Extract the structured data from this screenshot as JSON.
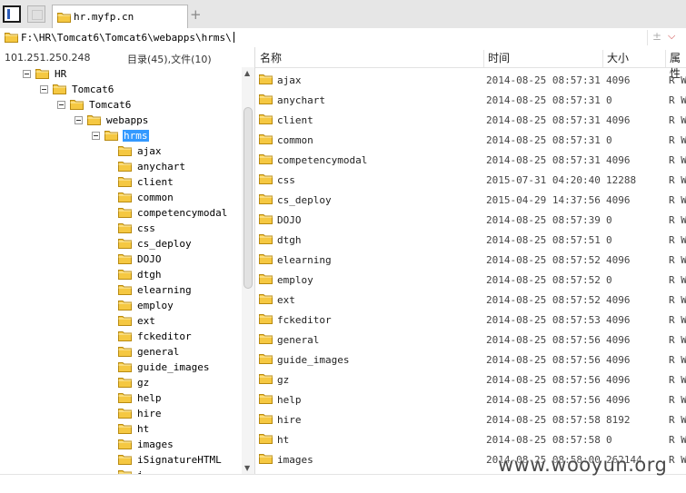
{
  "tab": {
    "title": "hr.myfp.cn",
    "add_label": "+"
  },
  "address": {
    "path": "F:\\HR\\Tomcat6\\Tomcat6\\webapps\\hrms\\",
    "plus": "±",
    "chevron": "⌵"
  },
  "left": {
    "ip": "101.251.250.248",
    "counts": "目录(45),文件(10)"
  },
  "columns": {
    "name": "名称",
    "time": "时间",
    "size": "大小",
    "attr": "属性"
  },
  "tree": [
    {
      "label": "HR",
      "depth": 0,
      "expanded": true
    },
    {
      "label": "Tomcat6",
      "depth": 1,
      "expanded": true
    },
    {
      "label": "Tomcat6",
      "depth": 2,
      "expanded": true
    },
    {
      "label": "webapps",
      "depth": 3,
      "expanded": true
    },
    {
      "label": "hrms",
      "depth": 4,
      "expanded": true,
      "selected": true
    },
    {
      "label": "ajax",
      "depth": 5
    },
    {
      "label": "anychart",
      "depth": 5
    },
    {
      "label": "client",
      "depth": 5
    },
    {
      "label": "common",
      "depth": 5
    },
    {
      "label": "competencymodal",
      "depth": 5
    },
    {
      "label": "css",
      "depth": 5
    },
    {
      "label": "cs_deploy",
      "depth": 5
    },
    {
      "label": "DOJO",
      "depth": 5
    },
    {
      "label": "dtgh",
      "depth": 5
    },
    {
      "label": "elearning",
      "depth": 5
    },
    {
      "label": "employ",
      "depth": 5
    },
    {
      "label": "ext",
      "depth": 5
    },
    {
      "label": "fckeditor",
      "depth": 5
    },
    {
      "label": "general",
      "depth": 5
    },
    {
      "label": "guide_images",
      "depth": 5
    },
    {
      "label": "gz",
      "depth": 5
    },
    {
      "label": "help",
      "depth": 5
    },
    {
      "label": "hire",
      "depth": 5
    },
    {
      "label": "ht",
      "depth": 5
    },
    {
      "label": "images",
      "depth": 5
    },
    {
      "label": "iSignatureHTML",
      "depth": 5
    },
    {
      "label": "i",
      "depth": 5
    }
  ],
  "files": [
    {
      "name": "ajax",
      "time": "2014-08-25 08:57:31",
      "size": "4096",
      "attr": "R W"
    },
    {
      "name": "anychart",
      "time": "2014-08-25 08:57:31",
      "size": "0",
      "attr": "R W"
    },
    {
      "name": "client",
      "time": "2014-08-25 08:57:31",
      "size": "4096",
      "attr": "R W"
    },
    {
      "name": "common",
      "time": "2014-08-25 08:57:31",
      "size": "0",
      "attr": "R W"
    },
    {
      "name": "competencymodal",
      "time": "2014-08-25 08:57:31",
      "size": "4096",
      "attr": "R W"
    },
    {
      "name": "css",
      "time": "2015-07-31 04:20:40",
      "size": "12288",
      "attr": "R W"
    },
    {
      "name": "cs_deploy",
      "time": "2015-04-29 14:37:56",
      "size": "4096",
      "attr": "R W"
    },
    {
      "name": "DOJO",
      "time": "2014-08-25 08:57:39",
      "size": "0",
      "attr": "R W"
    },
    {
      "name": "dtgh",
      "time": "2014-08-25 08:57:51",
      "size": "0",
      "attr": "R W"
    },
    {
      "name": "elearning",
      "time": "2014-08-25 08:57:52",
      "size": "4096",
      "attr": "R W"
    },
    {
      "name": "employ",
      "time": "2014-08-25 08:57:52",
      "size": "0",
      "attr": "R W"
    },
    {
      "name": "ext",
      "time": "2014-08-25 08:57:52",
      "size": "4096",
      "attr": "R W"
    },
    {
      "name": "fckeditor",
      "time": "2014-08-25 08:57:53",
      "size": "4096",
      "attr": "R W"
    },
    {
      "name": "general",
      "time": "2014-08-25 08:57:56",
      "size": "4096",
      "attr": "R W"
    },
    {
      "name": "guide_images",
      "time": "2014-08-25 08:57:56",
      "size": "4096",
      "attr": "R W"
    },
    {
      "name": "gz",
      "time": "2014-08-25 08:57:56",
      "size": "4096",
      "attr": "R W"
    },
    {
      "name": "help",
      "time": "2014-08-25 08:57:56",
      "size": "4096",
      "attr": "R W"
    },
    {
      "name": "hire",
      "time": "2014-08-25 08:57:58",
      "size": "8192",
      "attr": "R W"
    },
    {
      "name": "ht",
      "time": "2014-08-25 08:57:58",
      "size": "0",
      "attr": "R W"
    },
    {
      "name": "images",
      "time": "2014-08-25 08:58:00",
      "size": "262144",
      "attr": "R W"
    }
  ],
  "watermark": "www.wooyun.org",
  "colors": {
    "selection": "#3399ff",
    "folder_fill": "#f5c842",
    "folder_edge": "#b88a10",
    "close_red": "#c83232"
  },
  "icons": {
    "folder": "folder-icon",
    "expander": "collapse-icon"
  }
}
